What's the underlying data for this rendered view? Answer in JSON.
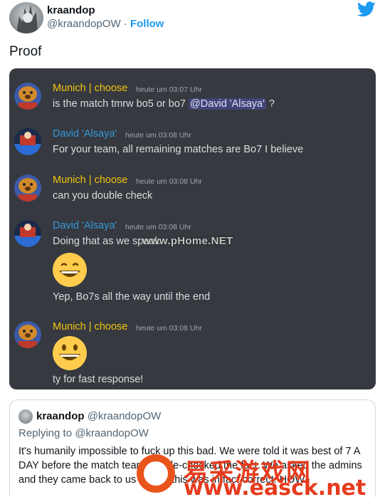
{
  "tweet": {
    "author_name": "kraandop",
    "author_handle": "@kraandopOW",
    "separator": "·",
    "follow_label": "Follow",
    "text": "Proof"
  },
  "discord": {
    "messages": [
      {
        "author": "Munich | choose",
        "author_color": "#f1c40f",
        "time": "heute um 03:07 Uhr",
        "text": "is the match tmrw bo5 or bo7 ",
        "mention": "@David 'Alsaya'",
        "text_after": " ?"
      },
      {
        "author": "David 'Alsaya'",
        "author_color": "#3498db",
        "time": "heute um 03:08 Uhr",
        "text": "For your team, all remaining matches are Bo7 I believe"
      },
      {
        "author": "Munich | choose",
        "author_color": "#f1c40f",
        "time": "heute um 03:08 Uhr",
        "text": "can you double check"
      },
      {
        "author": "David 'Alsaya'",
        "author_color": "#3498db",
        "time": "heute um 03:08 Uhr",
        "text": "Doing that as we speak",
        "emoji": "grinning-squinting-face",
        "text2": "Yep, Bo7s all the way until the end"
      },
      {
        "author": "Munich | choose",
        "author_color": "#f1c40f",
        "time": "heute um 03:08 Uhr",
        "emoji": "grinning-face",
        "text": "ty for fast response!"
      }
    ]
  },
  "watermarks": {
    "phome": "www.pHome.NET",
    "easck_cn": "易采游戏网",
    "easck_url": "www.easck.net"
  },
  "quoted_tweet": {
    "author_name": "kraandop",
    "author_handle": "@kraandopOW",
    "replying_to": "Replying to @kraandopOW",
    "body": "It's humanily impossible to fuck up this bad. We were told it was best of 7 A DAY before the match team double-checked the fact. We asked the admins and they came back to us saying this was in fact correct. HOW"
  }
}
